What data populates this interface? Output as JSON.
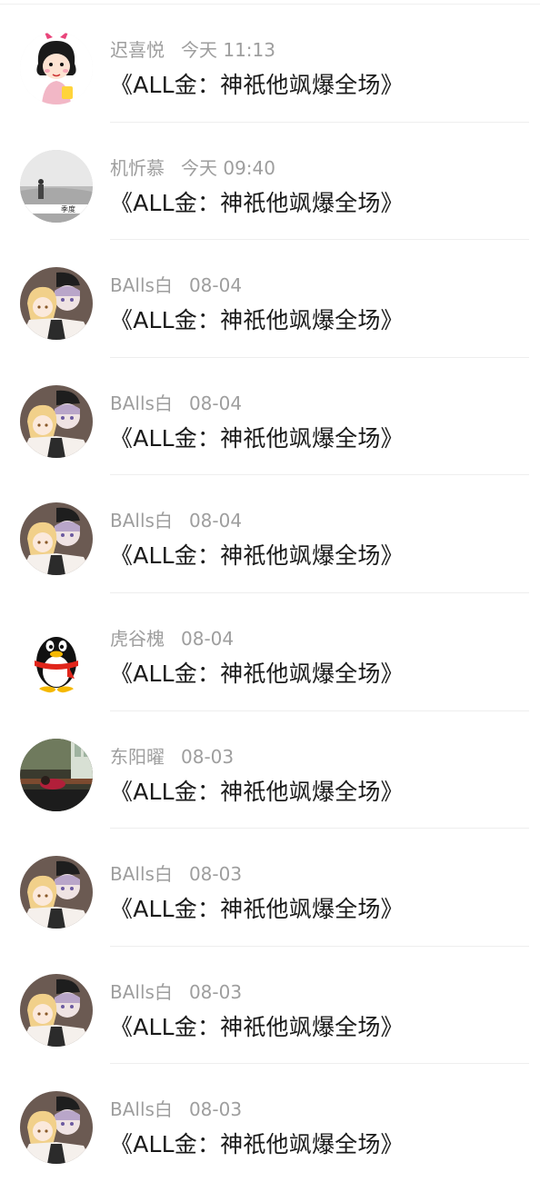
{
  "messages": [
    {
      "sender": "迟喜悦",
      "time": "今天 11:13",
      "text": "《ALL金：神祇他飒爆全场》",
      "avatar": "girl-cartoon"
    },
    {
      "sender": "机忻慕",
      "time": "今天 09:40",
      "text": "《ALL金：神祇他飒爆全场》",
      "avatar": "grey-photo"
    },
    {
      "sender": "BAlls白",
      "time": "08-04",
      "text": "《ALL金：神祇他飒爆全场》",
      "avatar": "anime-couple"
    },
    {
      "sender": "BAlls白",
      "time": "08-04",
      "text": "《ALL金：神祇他飒爆全场》",
      "avatar": "anime-couple"
    },
    {
      "sender": "BAlls白",
      "time": "08-04",
      "text": "《ALL金：神祇他飒爆全场》",
      "avatar": "anime-couple"
    },
    {
      "sender": "虎谷槐",
      "time": "08-04",
      "text": "《ALL金：神祇他飒爆全场》",
      "avatar": "qq-penguin"
    },
    {
      "sender": "东阳曜",
      "time": "08-03",
      "text": "《ALL金：神祇他飒爆全场》",
      "avatar": "classroom-photo"
    },
    {
      "sender": "BAlls白",
      "time": "08-03",
      "text": "《ALL金：神祇他飒爆全场》",
      "avatar": "anime-couple"
    },
    {
      "sender": "BAlls白",
      "time": "08-03",
      "text": "《ALL金：神祇他飒爆全场》",
      "avatar": "anime-couple"
    },
    {
      "sender": "BAlls白",
      "time": "08-03",
      "text": "《ALL金：神祇他飒爆全场》",
      "avatar": "anime-couple"
    }
  ]
}
